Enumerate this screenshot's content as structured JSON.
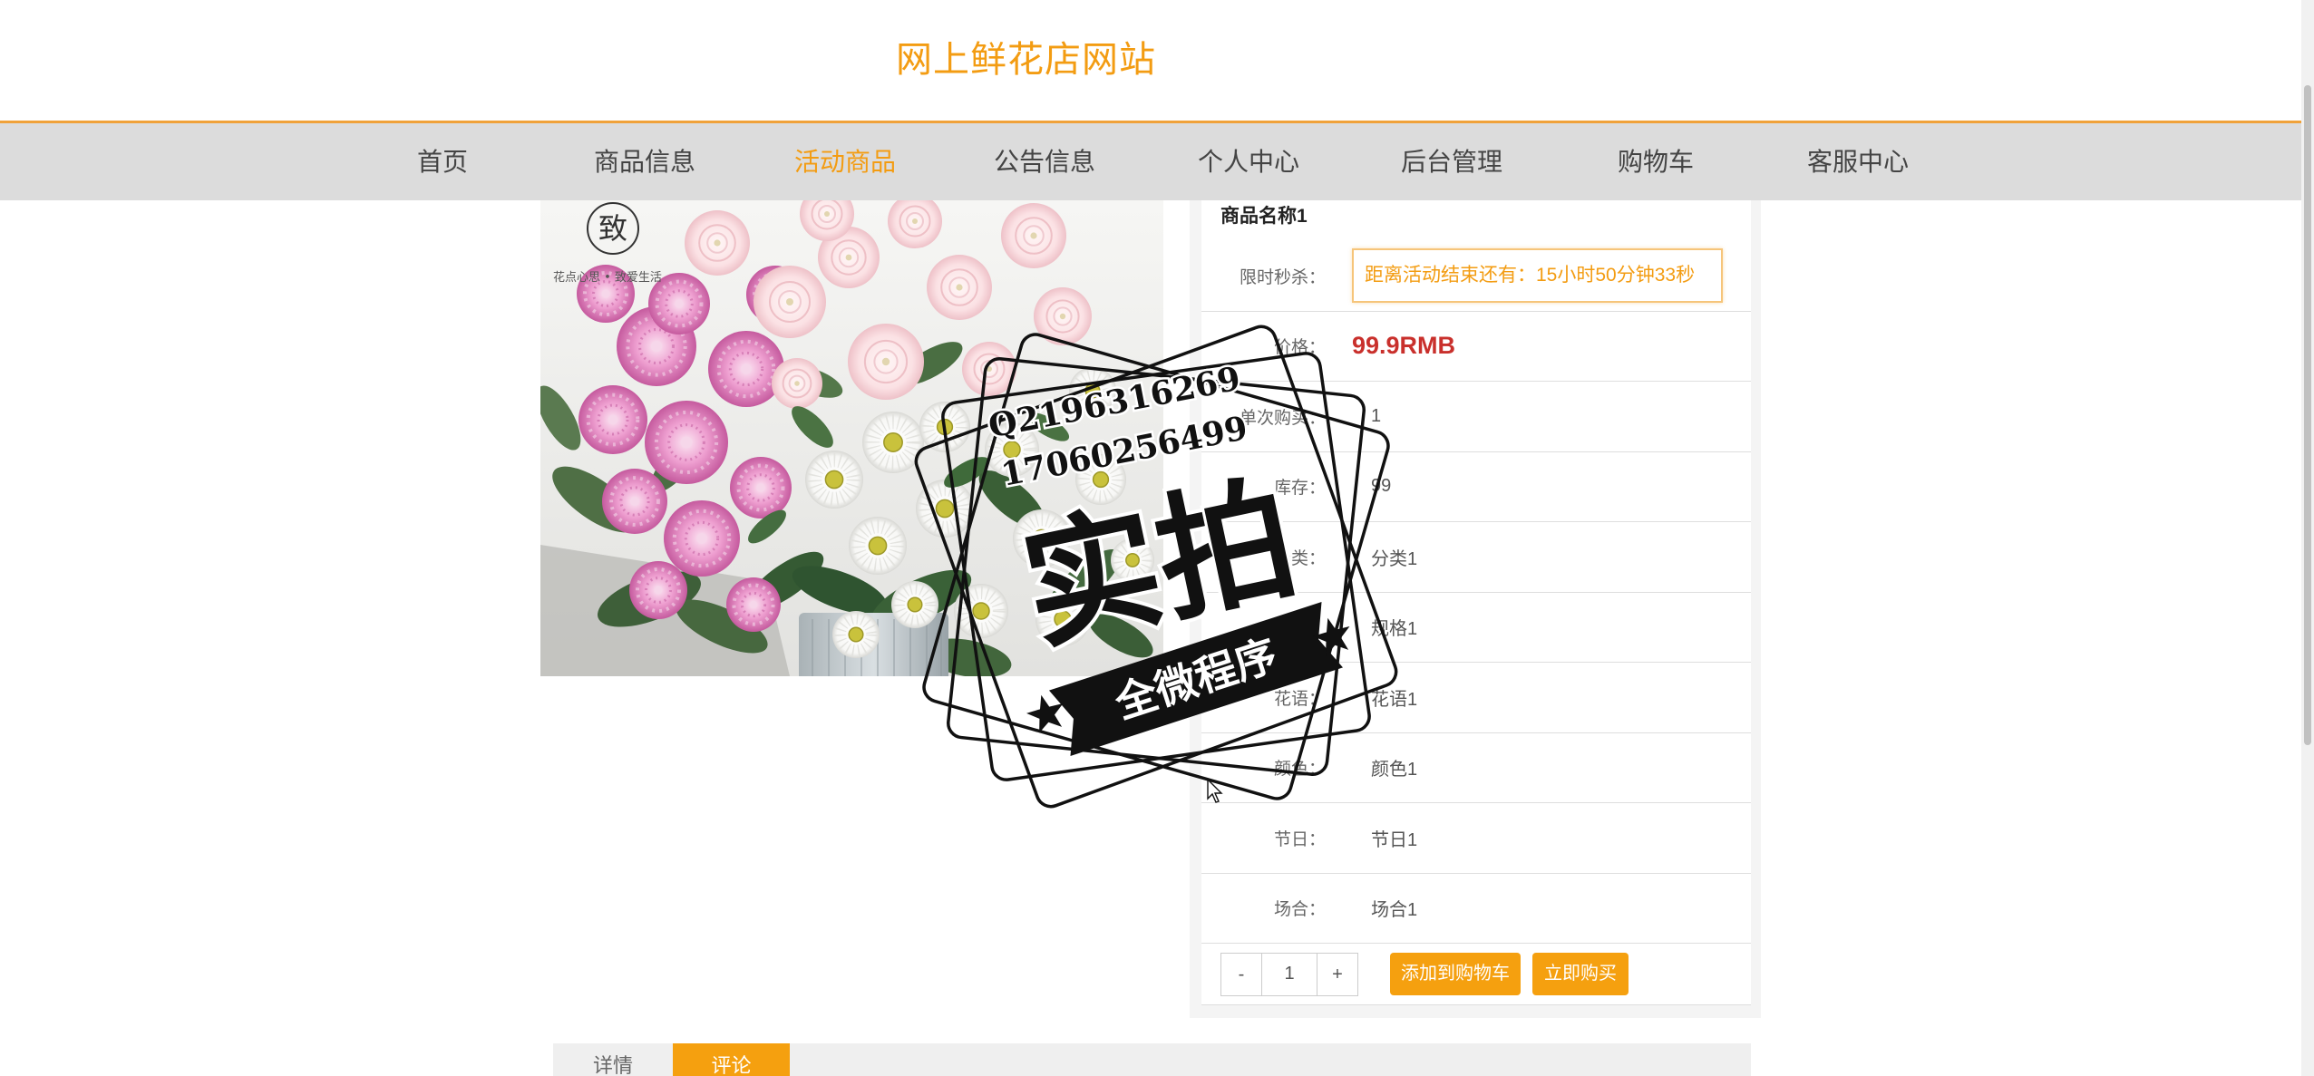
{
  "site": {
    "title": "网上鲜花店网站"
  },
  "nav": [
    {
      "label": "首页",
      "active": false
    },
    {
      "label": "商品信息",
      "active": false
    },
    {
      "label": "活动商品",
      "active": true
    },
    {
      "label": "公告信息",
      "active": false
    },
    {
      "label": "个人中心",
      "active": false
    },
    {
      "label": "后台管理",
      "active": false
    },
    {
      "label": "购物车",
      "active": false
    },
    {
      "label": "客服中心",
      "active": false
    }
  ],
  "product": {
    "image": {
      "logo_mark": "致",
      "logo_slogan": "花点心思 • 致爱生活"
    },
    "name": "商品名称1",
    "flash_sale": {
      "label": "限时秒杀：",
      "countdown": "距离活动结束还有：15小时50分钟33秒"
    },
    "price": {
      "label": "价格：",
      "value": "99.9RMB"
    },
    "attributes": [
      {
        "label": "单次购买：",
        "value": "1"
      },
      {
        "label": "库存：",
        "value": "99"
      },
      {
        "label": "分类：",
        "value": "分类1"
      },
      {
        "label": "规格：",
        "value": "规格1"
      },
      {
        "label": "花语：",
        "value": "花语1"
      },
      {
        "label": "颜色：",
        "value": "颜色1"
      },
      {
        "label": "节日：",
        "value": "节日1"
      },
      {
        "label": "场合：",
        "value": "场合1"
      }
    ],
    "quantity": {
      "minus": "-",
      "value": "1",
      "plus": "+"
    },
    "actions": {
      "add_to_cart": "添加到购物车",
      "buy_now": "立即购买"
    }
  },
  "tabs": [
    {
      "label": "详情",
      "active": false
    },
    {
      "label": "评论",
      "active": true
    }
  ],
  "watermark": {
    "qq": "Q2196316269",
    "phone": "17060256499",
    "main": "实拍",
    "ribbon": "全微程序"
  },
  "colors": {
    "accent": "#f39c12",
    "price": "#c9302c",
    "nav_bg": "#dcdcdc",
    "tab_bar": "#efefef"
  }
}
